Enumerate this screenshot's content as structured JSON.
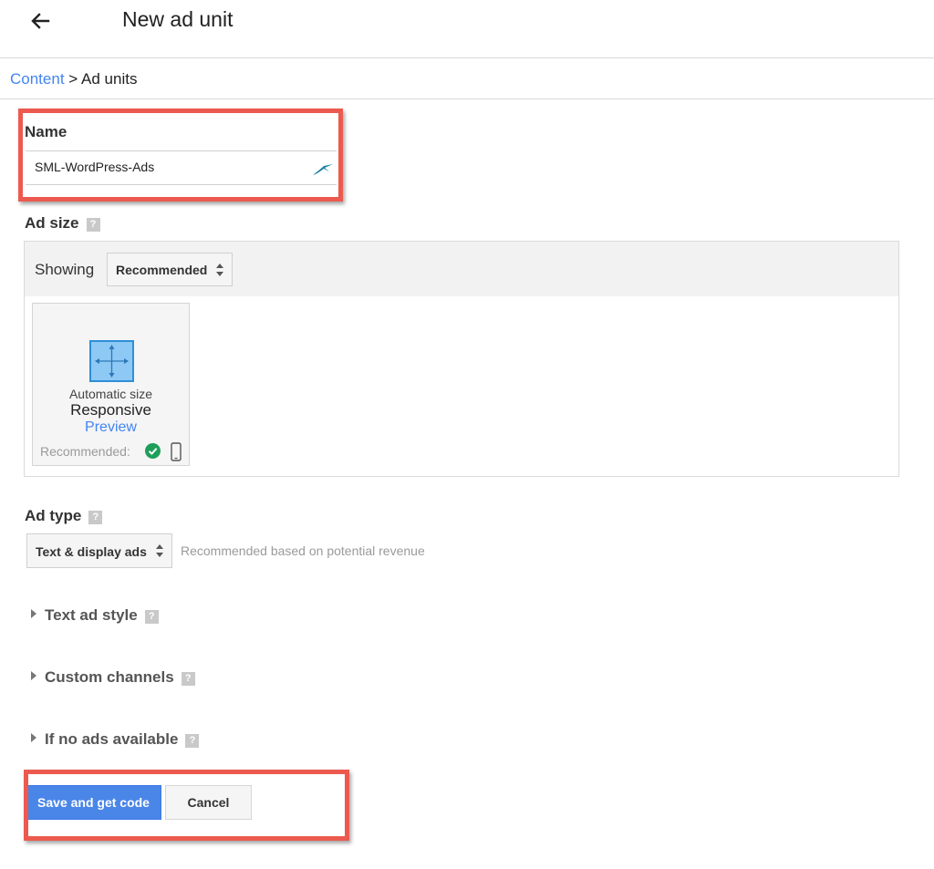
{
  "header": {
    "title": "New ad unit",
    "back_icon": "arrow-left-icon"
  },
  "breadcrumb": {
    "parent": "Content",
    "separator": ">",
    "current": "Ad units"
  },
  "name_section": {
    "label": "Name",
    "value": "SML-WordPress-Ads",
    "field_icon": "paper-plane-icon"
  },
  "ad_size": {
    "label": "Ad size",
    "help": "?",
    "showing_label": "Showing",
    "filter_value": "Recommended",
    "card": {
      "icon": "resize-arrows-icon",
      "line1": "Automatic size",
      "line2": "Responsive",
      "link": "Preview",
      "recommended_label": "Recommended:",
      "status_icon": "check-circle-icon",
      "device_icon": "mobile-phone-icon"
    }
  },
  "ad_type": {
    "label": "Ad type",
    "help": "?",
    "value": "Text & display ads",
    "note": "Recommended based on potential revenue"
  },
  "expanders": [
    {
      "label": "Text ad style",
      "help": "?"
    },
    {
      "label": "Custom channels",
      "help": "?"
    },
    {
      "label": "If no ads available",
      "help": "?"
    }
  ],
  "actions": {
    "save": "Save and get code",
    "cancel": "Cancel"
  },
  "colors": {
    "link": "#4285f4",
    "primary_button": "#4a86e8",
    "highlight": "#ec5a4f",
    "check": "#1e9e5a"
  }
}
